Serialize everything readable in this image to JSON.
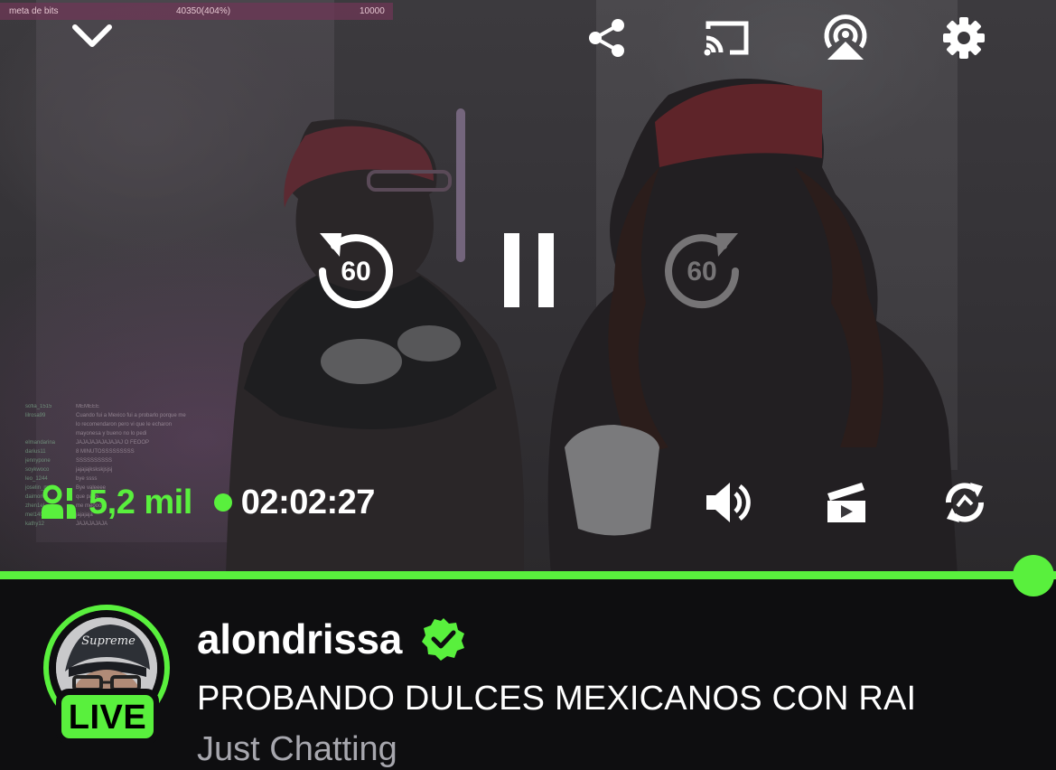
{
  "colors": {
    "accent": "#59f03d",
    "background": "#0e0e10",
    "muted_text": "#a7a7ae"
  },
  "stream_overlay": {
    "widget_label": "meta de bits",
    "widget_progress": "40350(404%)",
    "widget_goal": "10000",
    "chat_lines": [
      {
        "user": "sofia_1515",
        "text": "MEMEEE"
      },
      {
        "user": "lilrosa99",
        "text": "Cuando fui a Mexico fui a probarlo porque me"
      },
      {
        "user": "",
        "text": "lo recomendaron pero vi que le echaron"
      },
      {
        "user": "",
        "text": "mayonesa y bueno no lo pedi"
      },
      {
        "user": "elmandarina",
        "text": "JAJAJAJAJAJAJAJ O FEOOP"
      },
      {
        "user": "darius11",
        "text": "8 MINUTOSSSSSSSSS"
      },
      {
        "user": "jennypone",
        "text": "SSSSSSSSSS"
      },
      {
        "user": "soykwoco",
        "text": "jajajajkskskjsjsj"
      },
      {
        "user": "leo_1244",
        "text": "bye ssss"
      },
      {
        "user": "joselin_mx",
        "text": "Bye valeeee"
      },
      {
        "user": "daimon",
        "text": "que paso"
      },
      {
        "user": "zhen1el",
        "text": "me meooo"
      },
      {
        "user": "mel1400",
        "text": "jajajaja"
      },
      {
        "user": "kathy12",
        "text": "JAJAJAJAJA"
      }
    ]
  },
  "player_controls": {
    "collapse_icon": "chevron-down-icon",
    "share_icon": "share-icon",
    "cast_icon": "cast-icon",
    "airplay_icon": "airplay-icon",
    "settings_icon": "gear-icon",
    "rewind_seconds": "60",
    "forward_seconds": "60",
    "forward_enabled": false,
    "playback_state": "playing"
  },
  "status_bar": {
    "viewer_count": "5,2 mil",
    "elapsed_time": "02:02:27",
    "volume_icon": "speaker-icon",
    "clip_icon": "clip-icon",
    "rotate_icon": "rotate-icon"
  },
  "progress": {
    "fraction": 1.0
  },
  "channel": {
    "name": "alondrissa",
    "verified": true,
    "live_badge": "LIVE",
    "avatar_cap_text": "Supreme",
    "title": "PROBANDO DULCES MEXICANOS CON RAI",
    "category": "Just Chatting"
  }
}
